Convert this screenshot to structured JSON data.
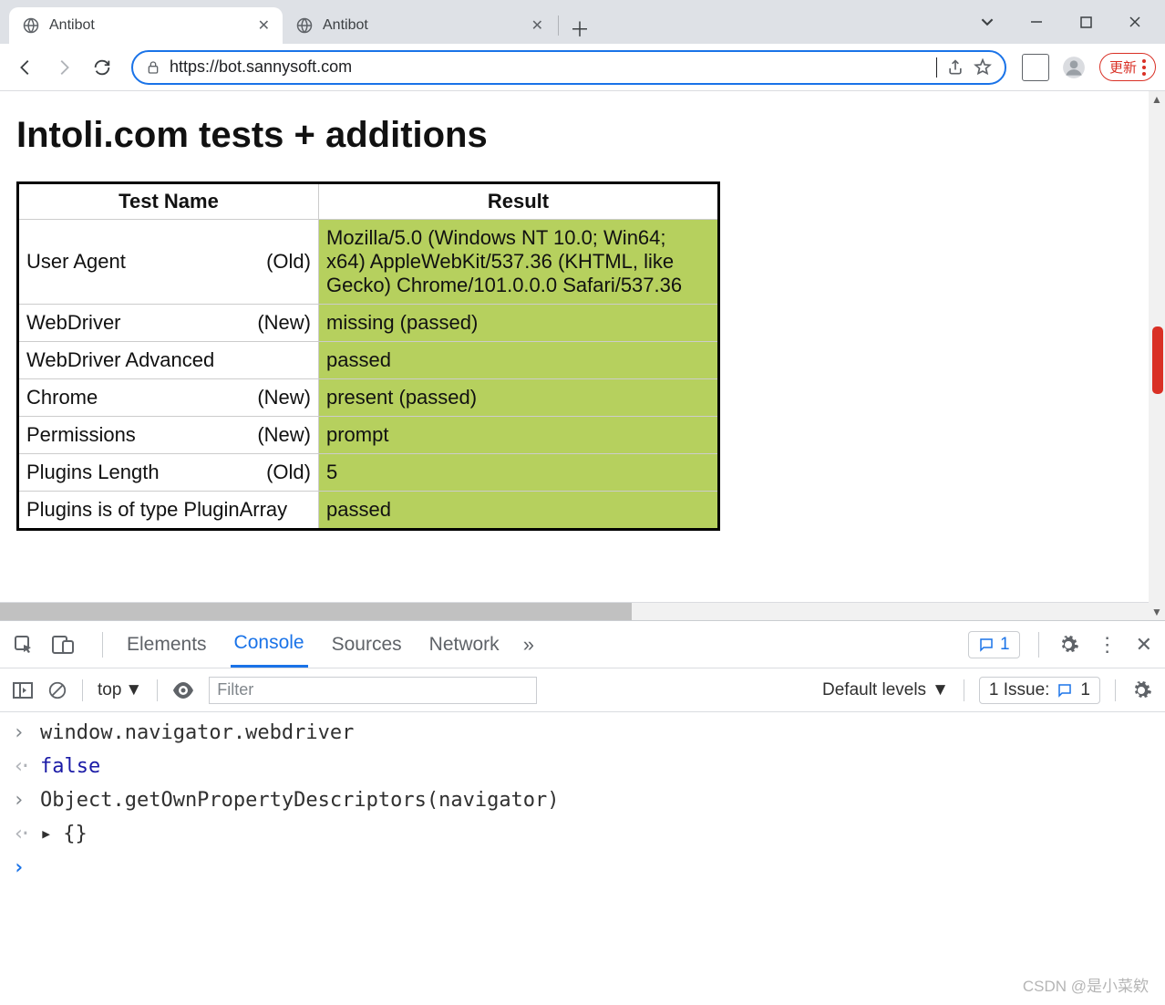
{
  "window": {
    "tabs": [
      {
        "title": "Antibot",
        "active": true
      },
      {
        "title": "Antibot",
        "active": false
      }
    ]
  },
  "toolbar": {
    "url": "https://bot.sannysoft.com",
    "update_label": "更新"
  },
  "page": {
    "heading": "Intoli.com tests + additions",
    "columns": {
      "name": "Test Name",
      "result": "Result"
    },
    "rows": [
      {
        "name": "User Agent",
        "tag": "(Old)",
        "result": "Mozilla/5.0 (Windows NT 10.0; Win64; x64) AppleWebKit/537.36 (KHTML, like Gecko) Chrome/101.0.0.0 Safari/537.36"
      },
      {
        "name": "WebDriver",
        "tag": "(New)",
        "result": "missing (passed)"
      },
      {
        "name": "WebDriver Advanced",
        "tag": "",
        "result": "passed"
      },
      {
        "name": "Chrome",
        "tag": "(New)",
        "result": "present (passed)"
      },
      {
        "name": "Permissions",
        "tag": "(New)",
        "result": "prompt"
      },
      {
        "name": "Plugins Length",
        "tag": "(Old)",
        "result": "5"
      },
      {
        "name": "Plugins is of type PluginArray",
        "tag": "",
        "result": "passed"
      }
    ]
  },
  "devtools": {
    "tabs": [
      "Elements",
      "Console",
      "Sources",
      "Network"
    ],
    "active_tab": "Console",
    "msg_count": "1",
    "context": "top",
    "filter_placeholder": "Filter",
    "levels": "Default levels",
    "issue_label": "1 Issue:",
    "issue_count": "1",
    "console": {
      "line1": "window.navigator.webdriver",
      "out1": "false",
      "line2": "Object.getOwnPropertyDescriptors(navigator)",
      "out2": "{}"
    }
  },
  "watermark": "CSDN @是小菜欸"
}
